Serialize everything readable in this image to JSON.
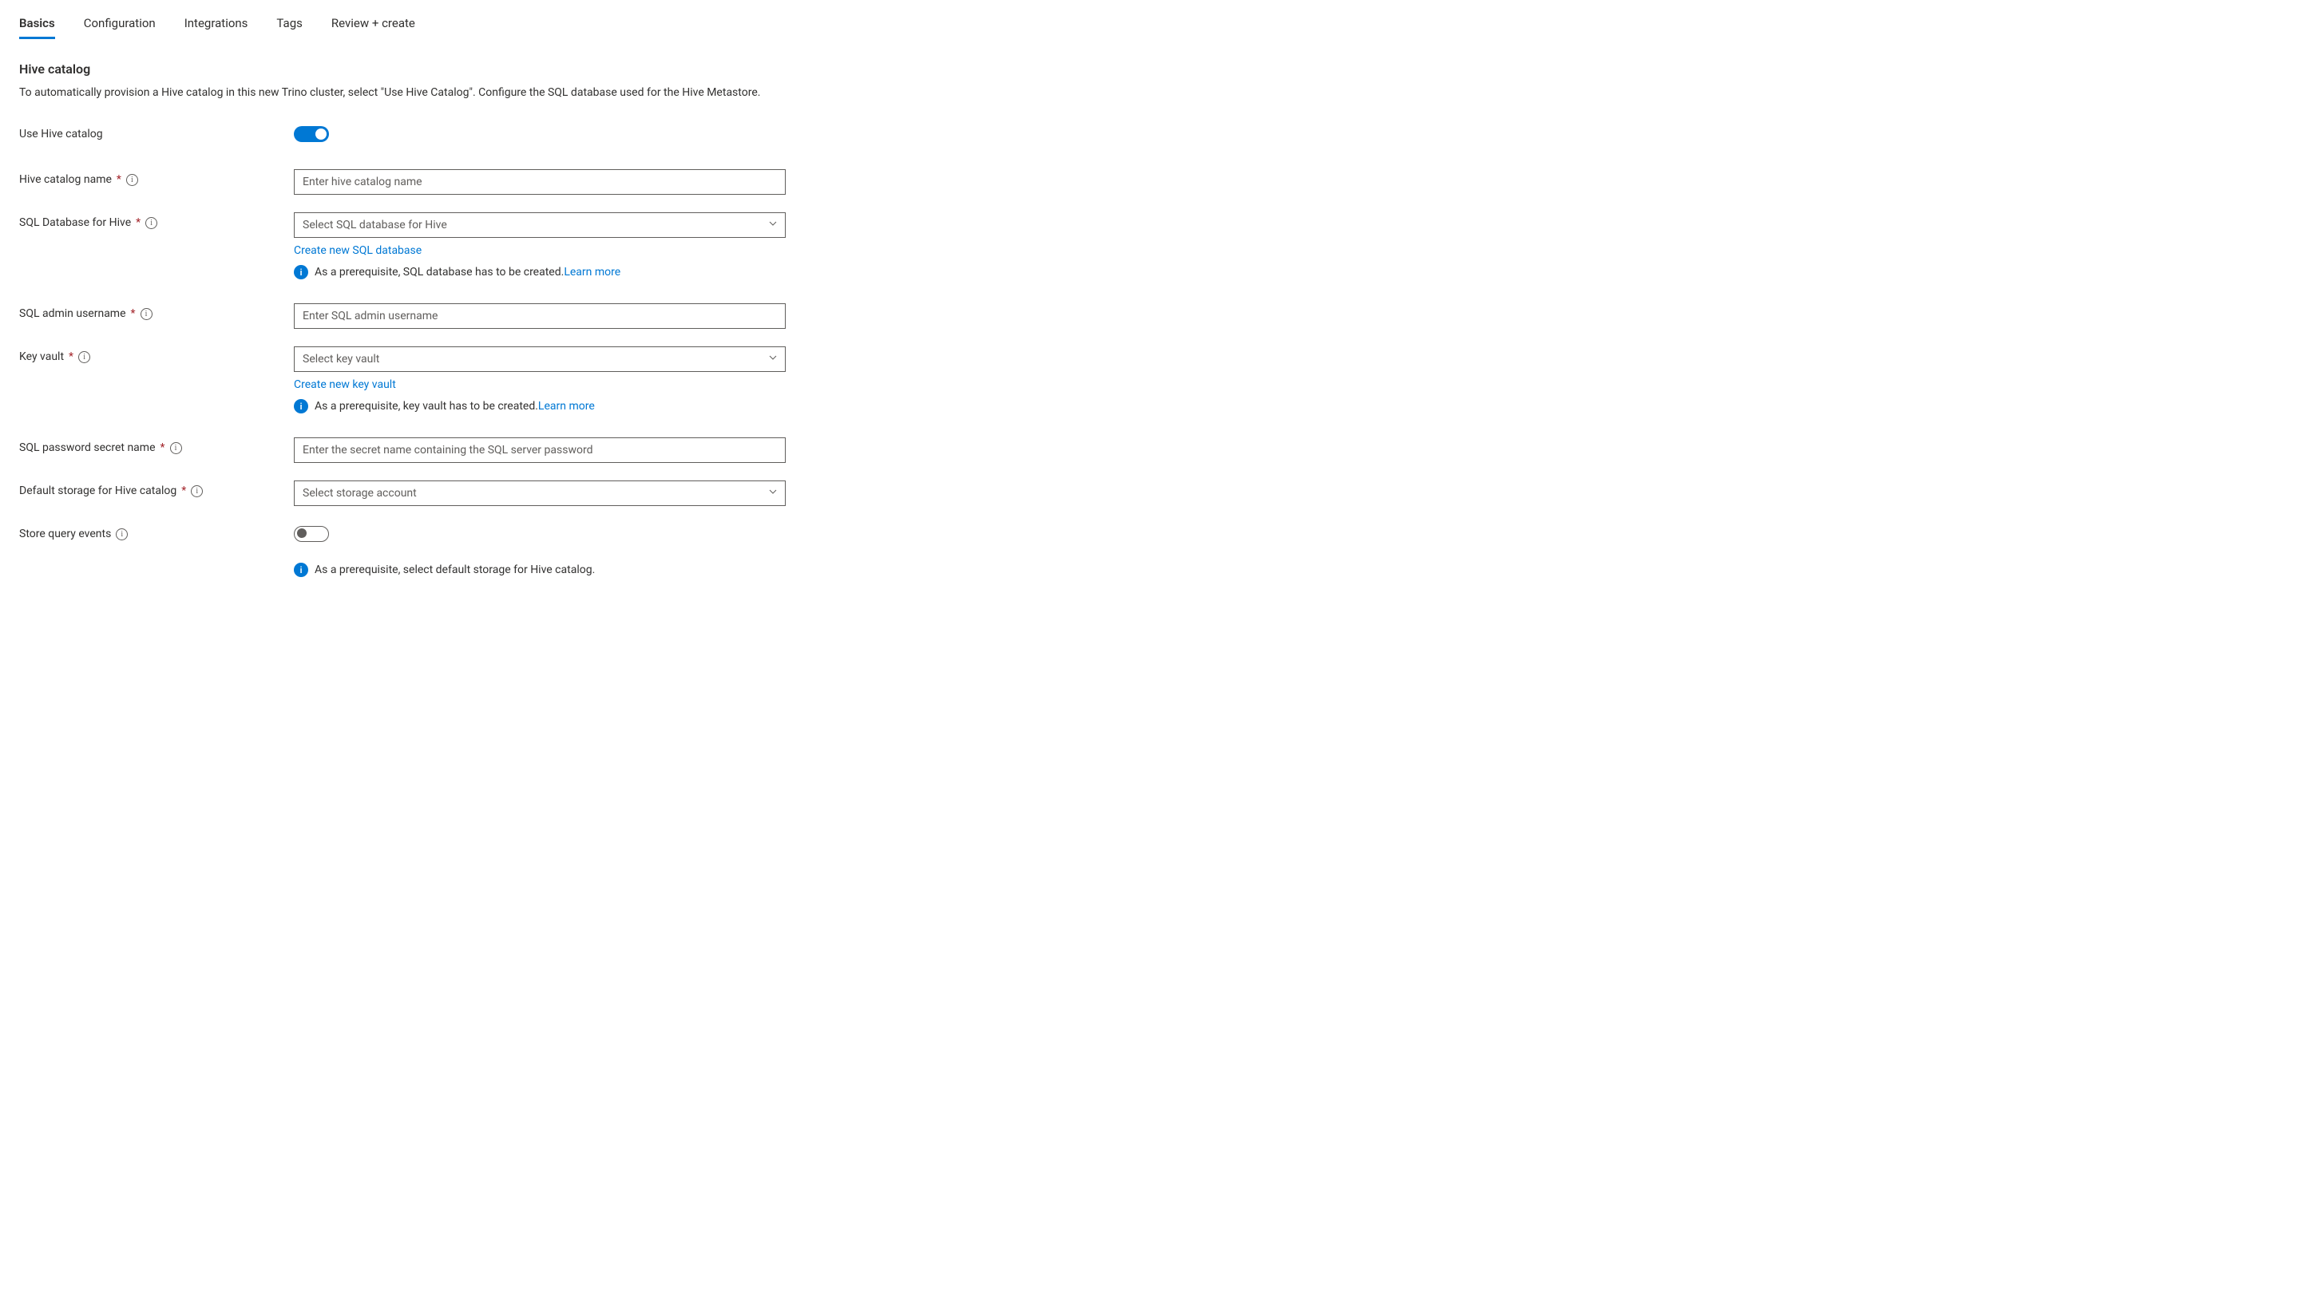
{
  "tabs": {
    "basics": "Basics",
    "configuration": "Configuration",
    "integrations": "Integrations",
    "tags": "Tags",
    "review": "Review + create"
  },
  "section": {
    "title": "Hive catalog",
    "description": "To automatically provision a Hive catalog in this new Trino cluster, select \"Use Hive Catalog\". Configure the SQL database used for the Hive Metastore."
  },
  "fields": {
    "use_hive_catalog": {
      "label": "Use Hive catalog"
    },
    "hive_catalog_name": {
      "label": "Hive catalog name",
      "placeholder": "Enter hive catalog name"
    },
    "sql_database": {
      "label": "SQL Database for Hive",
      "placeholder": "Select SQL database for Hive",
      "create_link": "Create new SQL database",
      "prereq_text": "As a prerequisite, SQL database has to be created.",
      "learn_more": "Learn more"
    },
    "sql_admin_username": {
      "label": "SQL admin username",
      "placeholder": "Enter SQL admin username"
    },
    "key_vault": {
      "label": "Key vault",
      "placeholder": "Select key vault",
      "create_link": "Create new key vault",
      "prereq_text": "As a prerequisite, key vault has to be created.",
      "learn_more": "Learn more"
    },
    "sql_password_secret": {
      "label": "SQL password secret name",
      "placeholder": "Enter the secret name containing the SQL server password"
    },
    "default_storage": {
      "label": "Default storage for Hive catalog",
      "placeholder": "Select storage account"
    },
    "store_query_events": {
      "label": "Store query events",
      "prereq_text": "As a prerequisite, select default storage for Hive catalog."
    }
  }
}
